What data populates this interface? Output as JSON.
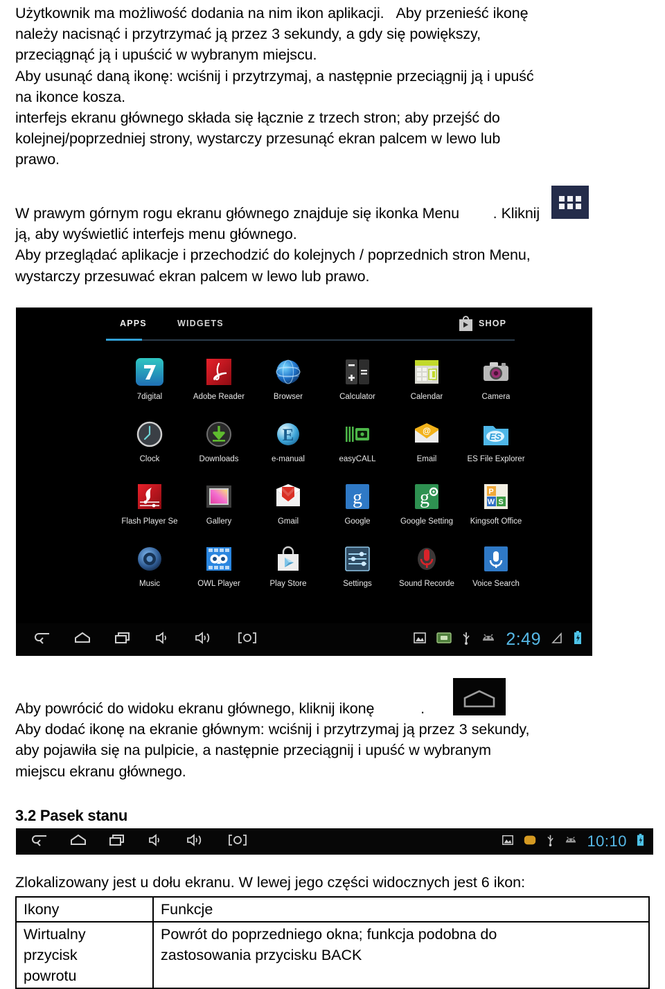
{
  "document": {
    "paragraph_a": {
      "lines": [
        "Użytkownik ma możliwość dodania na nim ikon aplikacji.   Aby przenieść ikonę",
        "należy nacisnąć i przytrzymać ją przez 3 sekundy, a gdy się powiększy,",
        "przeciągnąć ją i upuścić w wybranym miejscu.",
        "Aby usunąć daną ikonę: wciśnij i przytrzymaj, a następnie przeciągnij ją i upuść",
        "na ikonce kosza.",
        "interfejs ekranu głównego składa się łącznie z trzech stron; aby przejść do",
        "kolejnej/poprzedniej strony, wystarczy przesunąć ekran palcem w lewo lub",
        "prawo."
      ]
    },
    "paragraph_b": {
      "line1_before_icon": "W prawym górnym rogu ekranu głównego znajduje się ikonka Menu",
      "line1_after_icon": ". Kliknij",
      "lines_rest": [
        "ją, aby wyświetlić interfejs menu głównego.",
        "Aby przeglądać aplikacje i przechodzić do kolejnych / poprzednich stron Menu,",
        "wystarczy przesuwać ekran palcem w lewo lub prawo."
      ]
    },
    "paragraph_c": {
      "line1_before_icon": "Aby powrócić do widoku ekranu głównego, kliknij ikonę",
      "line1_after_icon": ".",
      "lines_rest": [
        "Aby dodać ikonę na ekranie głównym: wciśnij i przytrzymaj ją przez 3 sekundy,",
        "aby pojawiła się na pulpicie, a następnie przeciągnij i upuść w wybranym",
        "miejscu ekranu głównego."
      ]
    },
    "heading_32": "3.2 Pasek stanu",
    "bottom_intro": "Zlokalizowany jest u dołu ekranu. W lewej jego części widocznych jest 6 ikon:"
  },
  "inline_icons": {
    "menu_icon_name": "menu-grid-icon",
    "menu_icon_bg": "#242c4a",
    "home_icon_name": "home-icon",
    "home_icon_bg": "#050505"
  },
  "android_screenshot": {
    "tabs": [
      {
        "label": "APPS",
        "active": true
      },
      {
        "label": "WIDGETS",
        "active": false
      }
    ],
    "shop": {
      "label": "SHOP",
      "icon": "shopping-bag-play-icon"
    },
    "accent_color": "#32a0d6",
    "background": "#000000",
    "apps": [
      {
        "label": "7digital",
        "icon": "7digital-icon"
      },
      {
        "label": "Adobe Reader",
        "icon": "adobe-reader-icon"
      },
      {
        "label": "Browser",
        "icon": "browser-globe-icon"
      },
      {
        "label": "Calculator",
        "icon": "calculator-icon"
      },
      {
        "label": "Calendar",
        "icon": "calendar-icon"
      },
      {
        "label": "Camera",
        "icon": "camera-icon"
      },
      {
        "label": "Clock",
        "icon": "clock-icon"
      },
      {
        "label": "Downloads",
        "icon": "downloads-icon"
      },
      {
        "label": "e-manual",
        "icon": "e-manual-icon"
      },
      {
        "label": "easyCALL",
        "icon": "easycall-icon"
      },
      {
        "label": "Email",
        "icon": "email-envelope-icon"
      },
      {
        "label": "ES File Explorer",
        "icon": "es-file-explorer-icon"
      },
      {
        "label": "Flash Player Se",
        "icon": "flash-player-settings-icon"
      },
      {
        "label": "Gallery",
        "icon": "gallery-icon"
      },
      {
        "label": "Gmail",
        "icon": "gmail-icon"
      },
      {
        "label": "Google",
        "icon": "google-icon"
      },
      {
        "label": "Google Setting",
        "icon": "google-settings-icon"
      },
      {
        "label": "Kingsoft Office",
        "icon": "kingsoft-office-icon"
      },
      {
        "label": "Music",
        "icon": "music-speaker-icon"
      },
      {
        "label": "OWL Player",
        "icon": "owl-player-icon"
      },
      {
        "label": "Play Store",
        "icon": "play-store-icon"
      },
      {
        "label": "Settings",
        "icon": "settings-sliders-icon"
      },
      {
        "label": "Sound Recorde",
        "icon": "sound-recorder-icon"
      },
      {
        "label": "Voice Search",
        "icon": "voice-search-icon"
      }
    ],
    "navbar": {
      "left_icons": [
        "back-icon",
        "home-icon",
        "recents-icon",
        "volume-down-icon",
        "volume-up-icon",
        "screenshot-icon"
      ],
      "right_icons": [
        "screenshot-saved-icon",
        "sd-card-icon",
        "usb-icon",
        "android-debug-icon"
      ],
      "clock": "2:49",
      "signal_icon": "signal-icon",
      "battery_icon": "battery-charging-icon",
      "clock_color": "#56b8e6"
    }
  },
  "status_bar_strip": {
    "left_icons": [
      "back-icon",
      "home-icon",
      "recents-icon",
      "volume-down-icon",
      "volume-up-icon",
      "screenshot-icon"
    ],
    "right_icons": [
      "screenshot-saved-icon",
      "sd-card-icon",
      "usb-icon",
      "android-debug-icon"
    ],
    "clock": "10:10",
    "battery_icon": "battery-charging-icon",
    "clock_color": "#56b8e6"
  },
  "icon_table": {
    "headers": [
      "Ikony",
      "Funkcje"
    ],
    "rows": [
      {
        "icon_cell_lines": [
          "Wirtualny",
          "przycisk",
          "powrotu"
        ],
        "function_lines": [
          "Powrót do poprzedniego okna; funkcja podobna do",
          "zastosowania przycisku BACK"
        ]
      }
    ]
  }
}
